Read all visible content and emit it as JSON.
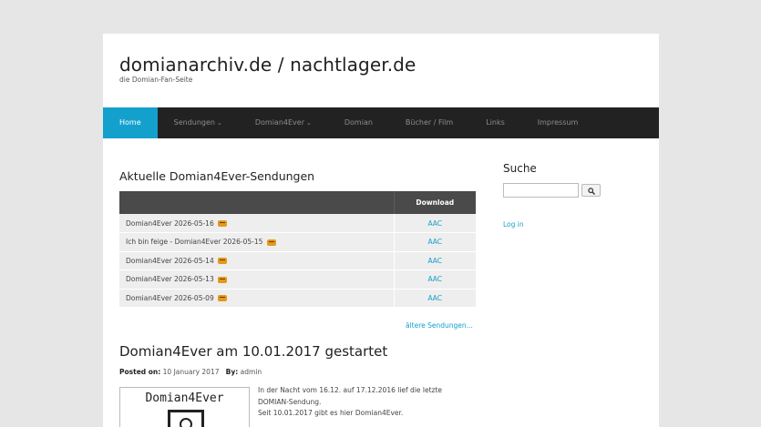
{
  "header": {
    "title": "domianarchiv.de / nachtlager.de",
    "description": "die Domian-Fan-Seite"
  },
  "nav": {
    "items": [
      {
        "label": "Home",
        "active": true,
        "dropdown": false
      },
      {
        "label": "Sendungen",
        "active": false,
        "dropdown": true
      },
      {
        "label": "Domian4Ever",
        "active": false,
        "dropdown": true
      },
      {
        "label": "Domian",
        "active": false,
        "dropdown": false
      },
      {
        "label": "Bücher / Film",
        "active": false,
        "dropdown": false
      },
      {
        "label": "Links",
        "active": false,
        "dropdown": false
      },
      {
        "label": "Impressum",
        "active": false,
        "dropdown": false
      }
    ]
  },
  "main": {
    "section_title": "Aktuelle Domian4Ever-Sendungen",
    "table": {
      "headers": [
        "",
        "Download"
      ],
      "rows": [
        {
          "title": "Domian4Ever 2026-05-16",
          "download": "AAC"
        },
        {
          "title": "Ich bin feige - Domian4Ever 2026-05-15",
          "download": "AAC"
        },
        {
          "title": "Domian4Ever 2026-05-14",
          "download": "AAC"
        },
        {
          "title": "Domian4Ever 2026-05-13",
          "download": "AAC"
        },
        {
          "title": "Domian4Ever 2026-05-09",
          "download": "AAC"
        }
      ]
    },
    "older_link": "ältere Sendungen..."
  },
  "post": {
    "title": "Domian4Ever am 10.01.2017 gestartet",
    "posted_on_label": "Posted on:",
    "date": "10 January 2017",
    "by_label": "By:",
    "author": "admin",
    "thumbnail_text": "Domian4Ever",
    "lines": [
      "In der Nacht vom 16.12. auf 17.12.2016 lief die letzte",
      "DOMIAN-Sendung.",
      "Seit 10.01.2017 gibt es hier Domian4Ever."
    ]
  },
  "sidebar": {
    "search_title": "Suche",
    "search_value": "",
    "login_link": "Log in"
  },
  "colors": {
    "accent": "#14a0cd",
    "nav_bg": "#222222",
    "page_bg": "#e6e6e6"
  }
}
